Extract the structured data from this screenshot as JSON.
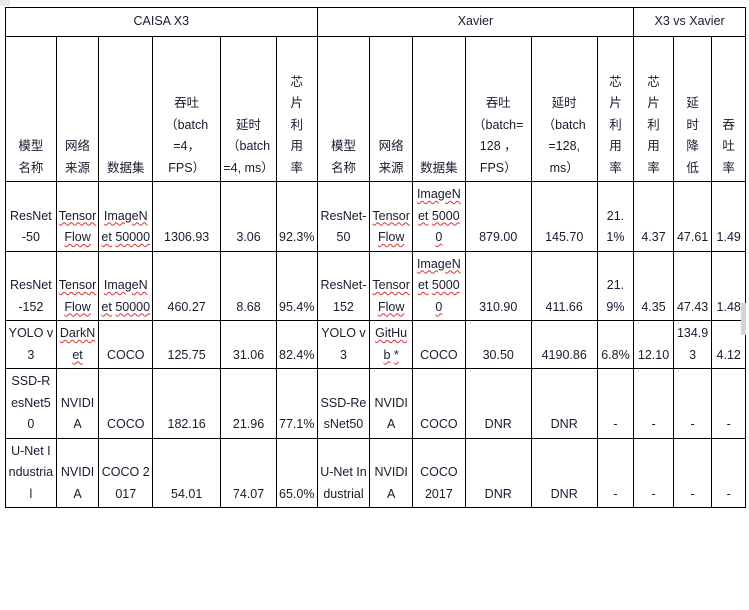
{
  "table": {
    "group_headers": [
      {
        "label": "CAISA X3",
        "span": 6
      },
      {
        "label": "Xavier",
        "span": 6
      },
      {
        "label": "X3 vs Xavier",
        "span": 3
      }
    ],
    "column_headers": [
      "模型名称",
      "网络来源",
      "数据集",
      "吞吐（batch=4，FPS）",
      "延时（batch=4, ms）",
      "芯片利用率",
      "模型名称",
      "网络来源",
      "数据集",
      "吞吐（batch=128，FPS）",
      "延时（batch=128, ms）",
      "芯片利用率",
      "芯片利用率",
      "延时降低",
      "吞吐率"
    ],
    "column_headers_lines": {
      "c0": [
        "模型",
        "名称"
      ],
      "c1": [
        "网络",
        "来源"
      ],
      "c2": [
        "数据集"
      ],
      "c3": [
        "吞吐",
        "（batch",
        "=4，",
        "FPS）"
      ],
      "c4": [
        "延时",
        "（batch",
        "=4, ms）"
      ],
      "c5": [
        "芯",
        "片",
        "利",
        "用",
        "率"
      ],
      "c6": [
        "模型",
        "名称"
      ],
      "c7": [
        "网络",
        "来源"
      ],
      "c8": [
        "数据集"
      ],
      "c9": [
        "吞吐",
        "（batch=",
        "128 ，",
        "FPS）"
      ],
      "c10": [
        "延时",
        "（batch",
        "=128,",
        "ms）"
      ],
      "c11": [
        "芯",
        "片",
        "利",
        "用",
        "率"
      ],
      "c12": [
        "芯",
        "片",
        "利",
        "用",
        "率"
      ],
      "c13": [
        "延",
        "时",
        "降",
        "低"
      ],
      "c14": [
        "吞",
        "吐",
        "率"
      ]
    },
    "rows": [
      {
        "x3_model": "ResNet-50",
        "x3_source": "TensorFlow",
        "x3_source_misspelled": true,
        "x3_dataset": "ImageNet 50000",
        "x3_dataset_misspelled": true,
        "x3_throughput": "1306.93",
        "x3_latency": "3.06",
        "x3_util": "92.3%",
        "xv_model": "ResNet-50",
        "xv_source": "TensorFlow",
        "xv_source_misspelled": true,
        "xv_dataset": "ImageNet 50000",
        "xv_dataset_misspelled": true,
        "xv_throughput": "879.00",
        "xv_latency": "145.70",
        "xv_util": "21.1%",
        "cmp_util": "4.37",
        "cmp_latency_drop": "47.61",
        "cmp_throughput_ratio": "1.49"
      },
      {
        "x3_model": "ResNet-152",
        "x3_source": "TensorFlow",
        "x3_source_misspelled": true,
        "x3_dataset": "ImageNet 50000",
        "x3_dataset_misspelled": true,
        "x3_throughput": "460.27",
        "x3_latency": "8.68",
        "x3_util": "95.4%",
        "xv_model": "ResNet-152",
        "xv_source": "TensorFlow",
        "xv_source_misspelled": true,
        "xv_dataset": "ImageNet 50000",
        "xv_dataset_misspelled": true,
        "xv_throughput": "310.90",
        "xv_latency": "411.66",
        "xv_util": "21.9%",
        "cmp_util": "4.35",
        "cmp_latency_drop": "47.43",
        "cmp_throughput_ratio": "1.48"
      },
      {
        "x3_model": "YOLO v3",
        "x3_source": "DarkNet",
        "x3_source_misspelled": true,
        "x3_dataset": "COCO",
        "x3_dataset_misspelled": false,
        "x3_throughput": "125.75",
        "x3_latency": "31.06",
        "x3_util": "82.4%",
        "xv_model": "YOLO v3",
        "xv_source": "GitHub *",
        "xv_source_misspelled": true,
        "xv_dataset": "COCO",
        "xv_dataset_misspelled": false,
        "xv_throughput": "30.50",
        "xv_latency": "4190.86",
        "xv_util": "6.8%",
        "cmp_util": "12.10",
        "cmp_latency_drop": "134.93",
        "cmp_throughput_ratio": "4.12"
      },
      {
        "x3_model": "SSD-ResNet50",
        "x3_source": "NVIDIA",
        "x3_source_misspelled": false,
        "x3_dataset": "COCO",
        "x3_dataset_misspelled": false,
        "x3_throughput": "182.16",
        "x3_latency": "21.96",
        "x3_util": "77.1%",
        "xv_model": "SSD-ResNet50",
        "xv_source": "NVIDIA",
        "xv_source_misspelled": false,
        "xv_dataset": "COCO",
        "xv_dataset_misspelled": false,
        "xv_throughput": "DNR",
        "xv_latency": "DNR",
        "xv_util": "-",
        "cmp_util": "-",
        "cmp_latency_drop": "-",
        "cmp_throughput_ratio": "-"
      },
      {
        "x3_model": "U-Net Industrial",
        "x3_source": "NVIDIA",
        "x3_source_misspelled": false,
        "x3_dataset": "COCO 2017",
        "x3_dataset_misspelled": false,
        "x3_throughput": "54.01",
        "x3_latency": "74.07",
        "x3_util": "65.0%",
        "xv_model": "U-Net Industrial",
        "xv_source": "NVIDIA",
        "xv_source_misspelled": false,
        "xv_dataset": "COCO 2017",
        "xv_dataset_misspelled": false,
        "xv_throughput": "DNR",
        "xv_latency": "DNR",
        "xv_util": "-",
        "cmp_util": "-",
        "cmp_latency_drop": "-",
        "cmp_throughput_ratio": "-"
      }
    ]
  },
  "colors": {
    "border": "#000000",
    "text": "#1a1a2e",
    "spellcheck": "#e03030",
    "background": "#ffffff"
  }
}
